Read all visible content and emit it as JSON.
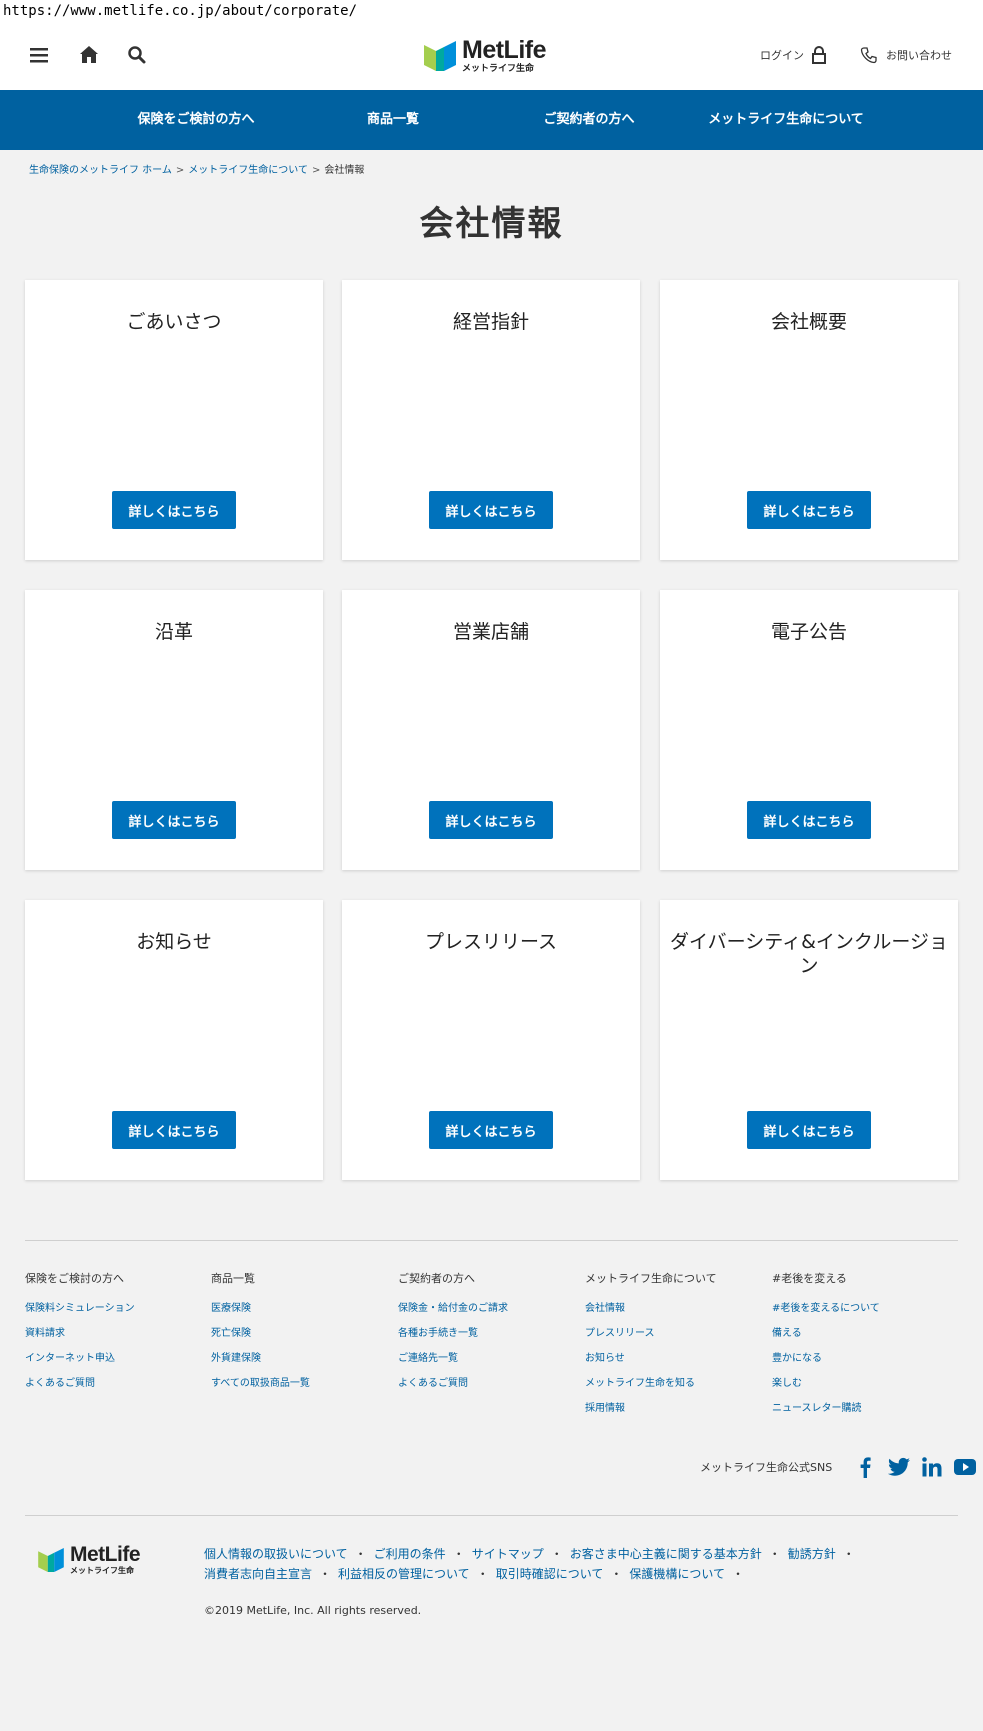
{
  "url": "https://www.metlife.co.jp/about/corporate/",
  "header": {
    "logo_main": "MetLife",
    "logo_sub": "メットライフ生命",
    "login_label": "ログイン",
    "contact_label": "お問い合わせ"
  },
  "nav": {
    "items": [
      {
        "label": "保険をご検討の方へ"
      },
      {
        "label": "商品一覧"
      },
      {
        "label": "ご契約者の方へ"
      },
      {
        "label": "メットライフ生命について"
      }
    ]
  },
  "breadcrumb": {
    "items": [
      "生命保険のメットライフ ホーム",
      "メットライフ生命について",
      "会社情報"
    ],
    "separator": ">"
  },
  "page_title": "会社情報",
  "cards": [
    {
      "title": "ごあいさつ",
      "button": "詳しくはこちら"
    },
    {
      "title": "経営指針",
      "button": "詳しくはこちら"
    },
    {
      "title": "会社概要",
      "button": "詳しくはこちら"
    },
    {
      "title": "沿革",
      "button": "詳しくはこちら"
    },
    {
      "title": "営業店舗",
      "button": "詳しくはこちら"
    },
    {
      "title": "電子公告",
      "button": "詳しくはこちら"
    },
    {
      "title": "お知らせ",
      "button": "詳しくはこちら"
    },
    {
      "title": "プレスリリース",
      "button": "詳しくはこちら"
    },
    {
      "title": "ダイバーシティ&インクルージョン",
      "button": "詳しくはこちら"
    }
  ],
  "footer": {
    "columns": [
      {
        "heading": "保険をご検討の方へ",
        "links": [
          "保険料シミュレーション",
          "資料請求",
          "インターネット申込",
          "よくあるご質問"
        ]
      },
      {
        "heading": "商品一覧",
        "links": [
          "医療保険",
          "死亡保険",
          "外貨建保険",
          "すべての取扱商品一覧"
        ]
      },
      {
        "heading": "ご契約者の方へ",
        "links": [
          "保険金・給付金のご請求",
          "各種お手続き一覧",
          "ご連絡先一覧",
          "よくあるご質問"
        ]
      },
      {
        "heading": "メットライフ生命について",
        "links": [
          "会社情報",
          "プレスリリース",
          "お知らせ",
          "メットライフ生命を知る",
          "採用情報"
        ]
      },
      {
        "heading": "#老後を変える",
        "links": [
          "#老後を変えるについて",
          "備える",
          "豊かになる",
          "楽しむ",
          "ニュースレター購読"
        ]
      }
    ],
    "sns_label": "メットライフ生命公式SNS",
    "sns_icons": [
      "facebook-icon",
      "twitter-icon",
      "linkedin-icon",
      "youtube-icon"
    ],
    "bottom_links": [
      "個人情報の取扱いについて",
      "ご利用の条件",
      "サイトマップ",
      "お客さま中心主義に関する基本方針",
      "勧誘方針",
      "消費者志向自主宣言",
      "利益相反の管理について",
      "取引時確認について",
      "保護機構について"
    ],
    "copyright": "©2019 MetLife, Inc. All rights reserved."
  },
  "colors": {
    "brand_blue": "#0061a0",
    "button_blue": "#0072bc",
    "logo_green": "#a4ce4e",
    "logo_blue": "#0090da"
  }
}
